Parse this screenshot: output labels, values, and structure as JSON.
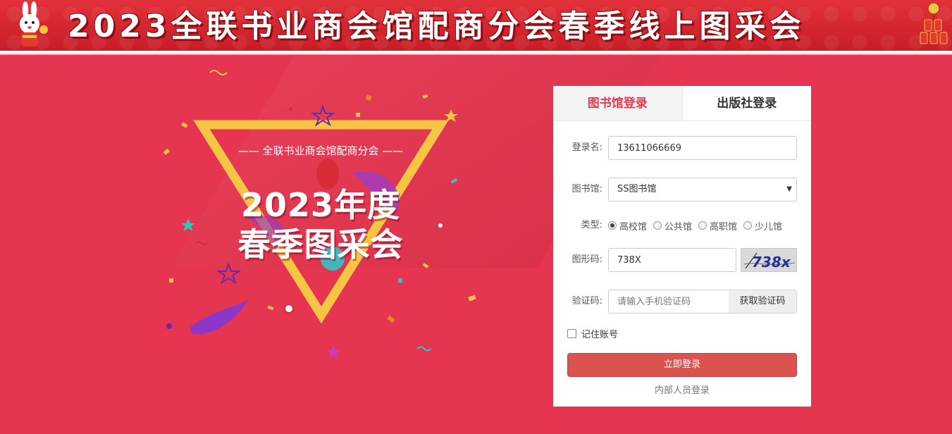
{
  "banner": {
    "title": "2023全联书业商会馆配商分会春季线上图采会"
  },
  "hero": {
    "subtitle": "—— 全联书业商会馆配商分会 ——",
    "title_line1": "2023年度",
    "title_line2": "春季图采会"
  },
  "login": {
    "tabs": [
      {
        "label": "图书馆登录",
        "active": true
      },
      {
        "label": "出版社登录",
        "active": false
      }
    ],
    "username": {
      "label": "登录名:",
      "value": "13611066669"
    },
    "library": {
      "label": "图书馆:",
      "selected": "SS图书馆"
    },
    "type": {
      "label": "类型:",
      "options": [
        {
          "label": "高校馆",
          "checked": true
        },
        {
          "label": "公共馆",
          "checked": false
        },
        {
          "label": "高职馆",
          "checked": false
        },
        {
          "label": "少儿馆",
          "checked": false
        }
      ]
    },
    "captcha": {
      "label": "图形码:",
      "value": "738X",
      "image_text": "738x"
    },
    "sms": {
      "label": "验证码:",
      "placeholder": "请输入手机验证码",
      "button": "获取验证码"
    },
    "remember": {
      "label": "记住账号",
      "checked": false
    },
    "submit": "立即登录",
    "internal_link": "内部人员登录"
  },
  "colors": {
    "background": "#e63550",
    "banner": "#d8242f",
    "accent": "#e43b4f",
    "submit": "#d9534f",
    "triangle": "#f6c544"
  }
}
